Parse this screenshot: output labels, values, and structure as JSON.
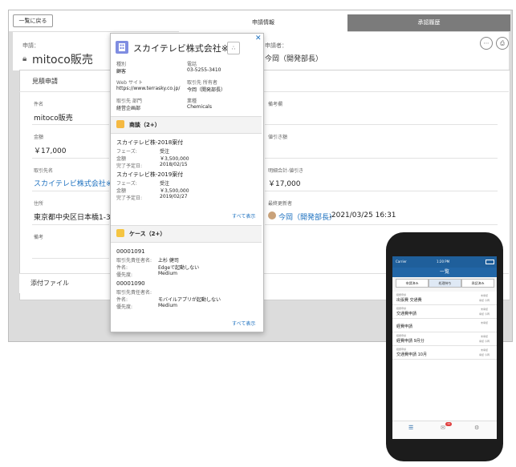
{
  "desktop": {
    "back_button": "一覧に戻る",
    "tabs": [
      "申請情報",
      "承認履歴"
    ],
    "applicant_left_label": "申請：",
    "record_title": "mitoco販売",
    "applicant_right_label": "申請者：",
    "applicant_name": "今岡（開発部長）",
    "section_title": "見積申請",
    "fields": {
      "subject_label": "件名",
      "subject_value": "mitoco販売",
      "notes_label": "備考欄",
      "amount_label": "金額",
      "amount_value": "￥17,000",
      "discount_label": "値引き額",
      "account_label": "取引先名",
      "account_value": "スカイテレビ株式会社※",
      "total_label": "明細合計-値引き",
      "total_value": "￥17,000",
      "address_label": "住所",
      "address_value": "東京都中央区日本橋1-3-1",
      "last_updated_label": "最終更新者",
      "last_updated_name": "今岡（開発部長）",
      "last_updated_time": ",2021/03/25 16:31",
      "remarks_label": "備考"
    },
    "attachments_title": "添付ファイル"
  },
  "popover": {
    "company_name": "スカイテレビ株式会社※",
    "type_label": "種別",
    "type_value": "顧客",
    "phone_label": "電話",
    "phone_value": "03-5255-3410",
    "website_label": "Web サイト",
    "website_value": "https://www.terrasky.co.jp/",
    "owner_label": "取引先 所有者",
    "owner_value": "今岡（開発部長）",
    "dept_label": "取引先 部門",
    "dept_value": "経営企画部",
    "industry_label": "業種",
    "industry_value": "Chemicals",
    "deals_title": "商談（2+）",
    "deals": [
      {
        "name": "スカイテレビ株-2018案付",
        "phase_label": "フェーズ:",
        "phase": "受注",
        "amount_label": "金額",
        "amount": "￥3,500,000",
        "date_label": "完了予定日:",
        "date": "2018/02/15"
      },
      {
        "name": "スカイテレビ株-2019案付",
        "phase_label": "フェーズ:",
        "phase": "受注",
        "amount_label": "金額",
        "amount": "￥3,500,000",
        "date_label": "完了予定日:",
        "date": "2019/02/27"
      }
    ],
    "show_all": "すべて表示",
    "cases_title": "ケース（2+）",
    "cases": [
      {
        "number": "00001091",
        "owner_label": "取引先責任者名:",
        "owner": "上杉 健司",
        "subject_label": "件名:",
        "subject": "Edgeで起動しない",
        "priority_label": "優先度:",
        "priority": "Medium"
      },
      {
        "number": "00001090",
        "owner_label": "取引先責任者名:",
        "owner": "",
        "subject_label": "件名:",
        "subject": "モバイルアプリが起動しない",
        "priority_label": "優先度:",
        "priority": "Medium"
      }
    ]
  },
  "phone": {
    "carrier": "Carrier",
    "time": "1:20 PM",
    "title": "一覧",
    "tabs": [
      "申請済み",
      "処理待ち",
      "承認済み"
    ],
    "rows": [
      {
        "label": "経費申請",
        "title": "出張費 交通費",
        "right_top": "未承認",
        "right_bottom": "承認 今岡"
      },
      {
        "label": "経費申請",
        "title": "交通費申請",
        "right_top": "未承認",
        "right_bottom": "承認 今岡"
      },
      {
        "label": "",
        "title": "経費申請",
        "right_top": "未承認",
        "right_bottom": ""
      },
      {
        "label": "経費申請",
        "title": "経費申請 9月分",
        "right_top": "未承認",
        "right_bottom": "承認 今岡"
      },
      {
        "label": "経費申請",
        "title": "交通費申請 10月",
        "right_top": "未承認",
        "right_bottom": "承認 今岡"
      }
    ],
    "badge": "10"
  },
  "colors": {
    "link": "#1a6fbf",
    "account_icon": "#7f8de1",
    "deal_icon": "#f5b942",
    "case_icon": "#f5c542",
    "phone_header": "#2266a6"
  }
}
